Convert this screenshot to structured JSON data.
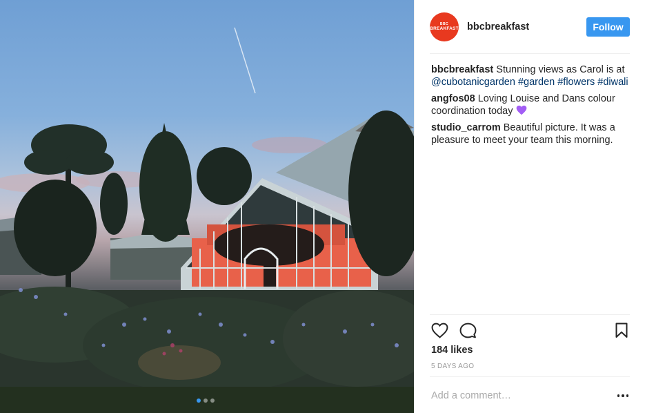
{
  "post": {
    "username": "bbcbreakfast",
    "avatar_text_top": "BBC",
    "avatar_text_bottom": "BREAKFAST",
    "follow_label": "Follow",
    "likes": "184 likes",
    "time_ago": "5 DAYS AGO",
    "add_comment_placeholder": "Add a comment…",
    "carousel": {
      "total": 3,
      "active_index": 0
    }
  },
  "caption": {
    "username": "bbcbreakfast",
    "text": "Stunning views as Carol is at",
    "mention": "@cubotanicgarden",
    "tags": [
      "#garden",
      "#flowers",
      "#diwali"
    ]
  },
  "comments": [
    {
      "username": "angfos08",
      "text": "Loving Louise and Dans colour coordination today",
      "emoji": "purple-heart"
    },
    {
      "username": "studio_carrom",
      "text": "Beautiful picture. It was a pleasure to meet your team this morning."
    }
  ],
  "icons": {
    "like": "heart-outline-icon",
    "comment": "speech-bubble-icon",
    "save": "bookmark-icon",
    "more": "more-options-icon"
  },
  "colors": {
    "accent": "#3897f0",
    "avatar_bg": "#e8391f",
    "link": "#003569",
    "purple_heart": "#a35ef5"
  }
}
